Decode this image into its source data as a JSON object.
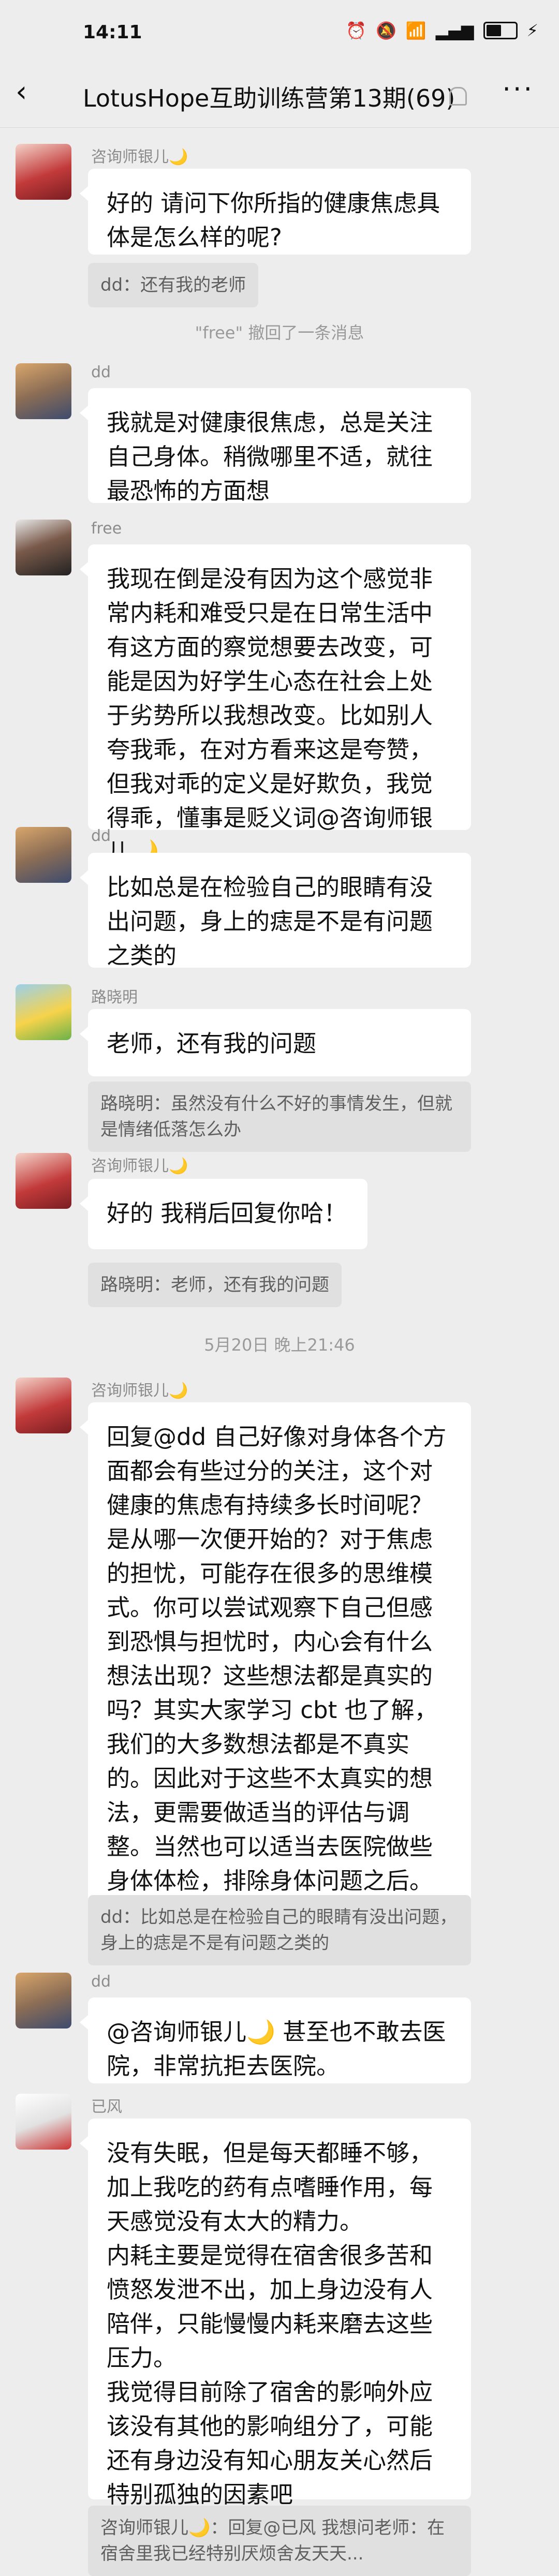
{
  "status": {
    "time": "14:11"
  },
  "header": {
    "title": "LotusHope互助训练营第13期(69)"
  },
  "colors": {
    "background": "#ededed",
    "bubble": "#ffffff",
    "quote": "#e0e0e0"
  },
  "messages": [
    {
      "sender": "咨询师银儿🌙",
      "text": "好的 请问下你所指的健康焦虑具体是怎么样的呢?",
      "quote": "dd：还有我的老师"
    },
    {
      "system": "\"free\" 撤回了一条消息"
    },
    {
      "sender": "dd",
      "text": "我就是对健康很焦虑，总是关注自己身体。稍微哪里不适，就往最恐怖的方面想"
    },
    {
      "sender": "free",
      "text": "我现在倒是没有因为这个感觉非常内耗和难受只是在日常生活中有这方面的察觉想要去改变，可能是因为好学生心态在社会上处于劣势所以我想改变。比如别人夸我乖，在对方看来这是夸赞，但我对乖的定义是好欺负，我觉得乖，懂事是贬义词@咨询师银儿🌙"
    },
    {
      "sender": "dd",
      "text": "比如总是在检验自己的眼睛有没出问题，身上的痣是不是有问题之类的"
    },
    {
      "sender": "路晓明",
      "text": "老师，还有我的问题",
      "quote": "路晓明：虽然没有什么不好的事情发生，但就是情绪低落怎么办"
    },
    {
      "sender": "咨询师银儿🌙",
      "text": "好的 我稍后回复你哈！",
      "quote": "路晓明：老师，还有我的问题"
    },
    {
      "system": "5月20日 晚上21:46"
    },
    {
      "sender": "咨询师银儿🌙",
      "text": "回复@dd 自己好像对身体各个方面都会有些过分的关注，这个对健康的焦虑有持续多长时间呢？是从哪一次便开始的？对于焦虑的担忧，可能存在很多的思维模式。你可以尝试观察下自己但感到恐惧与担忧时，内心会有什么想法出现？这些想法都是真实的吗？其实大家学习 cbt 也了解，我们的大多数想法都是不真实的。因此对于这些不太真实的想法，更需要做适当的评估与调整。当然也可以适当去医院做些身体体检，排除身体问题之后。我们才能更好地对想法、情绪对症下药。",
      "quote": "dd：比如总是在检验自己的眼睛有没出问题，身上的痣是不是有问题之类的"
    },
    {
      "sender": "dd",
      "text": "@咨询师银儿🌙  甚至也不敢去医院，非常抗拒去医院。"
    },
    {
      "sender": "已风",
      "text": "没有失眠，但是每天都睡不够，加上我吃的药有点嗜睡作用，每天感觉没有太大的精力。\n内耗主要是觉得在宿舍很多苦和愤怒发泄不出，加上身边没有人陪伴，只能慢慢内耗来磨去这些压力。\n我觉得目前除了宿舍的影响外应该没有其他的影响组分了，可能还有身边没有知心朋友关心然后特别孤独的因素吧",
      "quote": "咨询师银儿🌙：回复@已风  我想问老师：在宿舍里我已经特别厌烦舍友天天..."
    }
  ]
}
